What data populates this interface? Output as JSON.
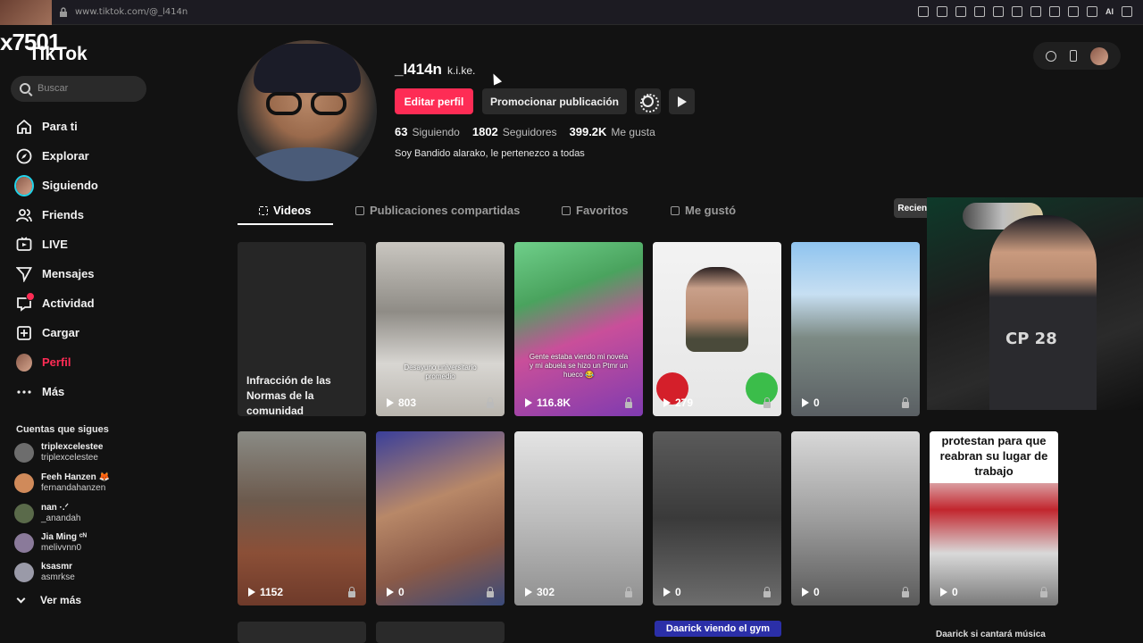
{
  "browser": {
    "url": "www.tiktok.com/@_l414n",
    "toolbar_right": "AI"
  },
  "overlay": {
    "number": "x7501"
  },
  "sidebar": {
    "logo": "TikTok",
    "search_placeholder": "Buscar",
    "items": [
      {
        "label": "Para ti",
        "icon": "home-icon"
      },
      {
        "label": "Explorar",
        "icon": "compass-icon"
      },
      {
        "label": "Siguiendo",
        "icon": "following-avatar-icon"
      },
      {
        "label": "Friends",
        "icon": "friends-icon"
      },
      {
        "label": "LIVE",
        "icon": "live-icon"
      },
      {
        "label": "Mensajes",
        "icon": "messages-icon"
      },
      {
        "label": "Actividad",
        "icon": "activity-icon"
      },
      {
        "label": "Cargar",
        "icon": "upload-icon"
      },
      {
        "label": "Perfil",
        "icon": "profile-avatar-icon"
      },
      {
        "label": "Más",
        "icon": "more-icon"
      }
    ],
    "following_title": "Cuentas que sigues",
    "accounts": [
      {
        "display": "triplexcelestee",
        "handle": "triplexcelestee",
        "color": "#6d6d6d"
      },
      {
        "display": "Feeh Hanzen 🦊",
        "handle": "fernandahanzen",
        "color": "#d08a5a"
      },
      {
        "display": "nan ·.ᐟ",
        "handle": "_anandah",
        "color": "#5a6a4a"
      },
      {
        "display": "Jia Ming ᶜᴺ",
        "handle": "melivvnn0",
        "color": "#8a7a9a"
      },
      {
        "display": "ksasmr",
        "handle": "asmrkse",
        "color": "#9a9aa8"
      }
    ],
    "see_more": "Ver más"
  },
  "profile": {
    "username": "_l414n",
    "nickname": "k.i.ke.",
    "edit_button": "Editar perfil",
    "promote_button": "Promocionar publicación",
    "stats": {
      "following_count": "63",
      "following_label": "Siguiendo",
      "followers_count": "1802",
      "followers_label": "Seguidores",
      "likes_count": "399.2K",
      "likes_label": "Me gusta"
    },
    "bio": "Soy Bandido alarako, le pertenezco a todas"
  },
  "tabs": [
    {
      "label": "Videos",
      "active": true
    },
    {
      "label": "Publicaciones compartidas",
      "active": false
    },
    {
      "label": "Favoritos",
      "active": false
    },
    {
      "label": "Me gustó",
      "active": false
    }
  ],
  "sort_label": "Recientes",
  "videos": [
    {
      "views": "",
      "caption": "",
      "violation": "Infracción de las Normas de la comunidad"
    },
    {
      "views": "803",
      "caption": "Desayuno universitario promedio",
      "violation": ""
    },
    {
      "views": "116.8K",
      "caption": "Gente estaba viendo mi novela y mi abuela se hizo un Ptmr un hueco 😂",
      "violation": ""
    },
    {
      "views": "279",
      "caption": "",
      "violation": ""
    },
    {
      "views": "0",
      "caption": "",
      "violation": ""
    },
    {
      "views": "1152",
      "caption": "",
      "violation": ""
    },
    {
      "views": "0",
      "caption": "",
      "violation": ""
    },
    {
      "views": "302",
      "caption": "",
      "violation": ""
    },
    {
      "views": "0",
      "caption": "",
      "violation": ""
    },
    {
      "views": "0",
      "caption": "",
      "violation": ""
    },
    {
      "views": "0",
      "caption": "protestan para que reabran su lugar de trabajo",
      "violation": ""
    }
  ],
  "webcam": {
    "hoodie_text": "CP 28"
  },
  "bottom": {
    "pill": "Daarick viendo el gym",
    "right_text": "Daarick si cantará música"
  },
  "colors": {
    "accent": "#fe2c55",
    "background": "#121212"
  }
}
